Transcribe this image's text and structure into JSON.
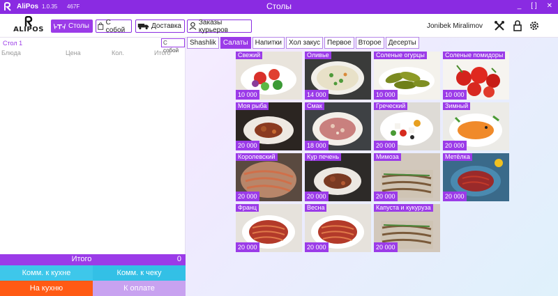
{
  "titlebar": {
    "app_name": "AliPos",
    "version": "1.0.35",
    "code": "467F",
    "title": "Столы",
    "controls": [
      "_",
      "[ ]",
      "✕"
    ]
  },
  "header": {
    "logo_text": "ALIPOS",
    "nav": [
      {
        "label": "Столы",
        "active": true,
        "icon": "tables-icon"
      },
      {
        "label": "С собой",
        "active": false,
        "icon": "takeaway-icon"
      },
      {
        "label": "Доставка",
        "active": false,
        "icon": "truck-icon"
      },
      {
        "label": "Заказы курьеров",
        "active": false,
        "icon": "courier-icon"
      }
    ],
    "user_name": "Jonibek Miralimov"
  },
  "order": {
    "table_name": "Стол 1",
    "takeaway_label": "С собой",
    "columns": [
      "Блюда",
      "Цена",
      "Кол.",
      "Итого"
    ],
    "total_label": "Итого",
    "total_value": "0",
    "buttons": {
      "kitchen_comment": "Комм. к кухне",
      "check_comment": "Комм. к чеку",
      "to_kitchen": "На кухню",
      "to_payment": "К оплате"
    }
  },
  "tabs": [
    {
      "label": "Shashlik",
      "active": false
    },
    {
      "label": "Салаты",
      "active": true
    },
    {
      "label": "Напитки",
      "active": false
    },
    {
      "label": "Хол закус",
      "active": false
    },
    {
      "label": "Первое",
      "active": false
    },
    {
      "label": "Второе",
      "active": false
    },
    {
      "label": "Десерты",
      "active": false
    }
  ],
  "products": [
    {
      "name": "Свежий",
      "price": "10 000",
      "image": "fresh-salad"
    },
    {
      "name": "Оливье",
      "price": "14 000",
      "image": "olivier-salad"
    },
    {
      "name": "Соленые огурцы",
      "price": "10 000",
      "image": "pickles"
    },
    {
      "name": "Соленые помидоры",
      "price": "10 000",
      "image": "pickled-tomatoes"
    },
    {
      "name": "Моя рыба",
      "price": "20 000",
      "image": "fish-salad"
    },
    {
      "name": "Смак",
      "price": "18 000",
      "image": "smak-salad"
    },
    {
      "name": "Греческий",
      "price": "20 000",
      "image": "greek-salad"
    },
    {
      "name": "Зимный",
      "price": "20 000",
      "image": "winter-salad"
    },
    {
      "name": "Королевский",
      "price": "20 000",
      "image": "royal-salad"
    },
    {
      "name": "Кур печень",
      "price": "20 000",
      "image": "liver-salad"
    },
    {
      "name": "Мимоза",
      "price": "20 000",
      "image": "mimosa-salad"
    },
    {
      "name": "Метёлка",
      "price": "20 000",
      "image": "metelka-salad"
    },
    {
      "name": "Франц",
      "price": "20 000",
      "image": "french-salad"
    },
    {
      "name": "Весна",
      "price": "20 000",
      "image": "spring-salad"
    },
    {
      "name": "Капуста и кукуруза",
      "price": "20 000",
      "image": "cabbage-corn-salad"
    }
  ],
  "colors": {
    "accent": "#9b3be8",
    "titlebar": "#8a2be2",
    "teal": "#33c6e8",
    "orange": "#ff5a14",
    "lilac": "#c8a2f0"
  }
}
